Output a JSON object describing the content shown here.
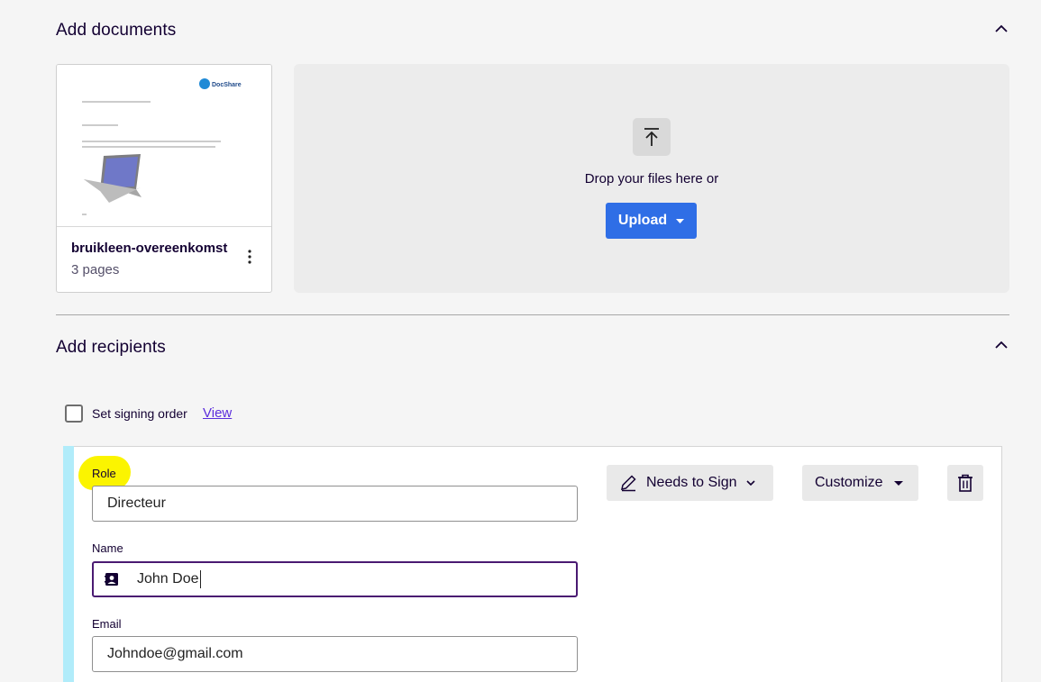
{
  "documents_section": {
    "title": "Add documents",
    "document": {
      "name": "bruikleen-overeenkomst",
      "pages": "3 pages",
      "thumbnail_logo": "DocShare"
    },
    "dropzone": {
      "text": "Drop your files here or",
      "upload_label": "Upload"
    }
  },
  "recipients_section": {
    "title": "Add recipients",
    "signing_order_label": "Set signing order",
    "signing_order_checked": false,
    "view_link": "View",
    "recipient": {
      "role_label": "Role",
      "role_value": "Directeur",
      "name_label": "Name",
      "name_value": "John Doe",
      "email_label": "Email",
      "email_value": "Johndoe@gmail.com",
      "action_label": "Needs to Sign",
      "customize_label": "Customize"
    }
  },
  "colors": {
    "primary": "#2f6ee6",
    "text": "#130032",
    "link": "#5b2ddc",
    "stripe": "#b1ecfa",
    "highlight": "#fbf400",
    "focus_border": "#4a1a72"
  },
  "icons": [
    "chevron-up-icon",
    "kebab-menu-icon",
    "upload-arrow-icon",
    "caret-down-icon",
    "pen-icon",
    "chevron-down-icon",
    "trash-icon",
    "contact-card-icon"
  ]
}
